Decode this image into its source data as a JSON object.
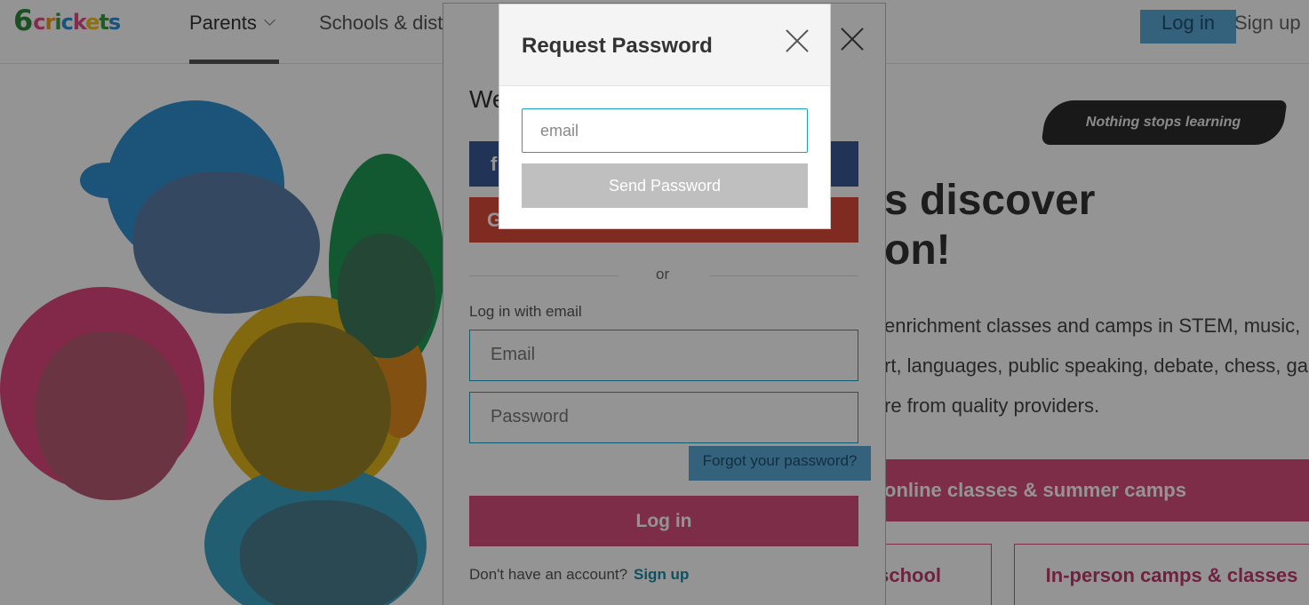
{
  "header": {
    "logo_text": "6crickets",
    "nav_parents": "Parents",
    "nav_schools": "Schools & dist",
    "login_label": "Log in",
    "signup_label": "Sign up"
  },
  "hero": {
    "tagline": "Nothing stops learning",
    "title_line1": "s discover",
    "title_line2": "on!",
    "desc_line1": "enrichment classes and camps in STEM, music,",
    "desc_line2": "rt, languages, public speaking, debate, chess, game",
    "desc_line3": "re from quality providers.",
    "cta_online": "online classes & summer camps",
    "cta_school": "school",
    "cta_inperson": "In-person camps & classes"
  },
  "login_modal": {
    "welcome_text": "We",
    "facebook_label": "f",
    "google_label": "G",
    "or_text": "or",
    "email_section_label": "Log in with email",
    "email_placeholder": "Email",
    "password_placeholder": "Password",
    "forgot_label": "Forgot your password?",
    "submit_label": "Log in",
    "no_account_text": "Don't have an account?",
    "signup_label": "Sign up"
  },
  "request_modal": {
    "title": "Request Password",
    "email_placeholder": "email",
    "email_value": "",
    "send_label": "Send Password"
  },
  "colors": {
    "accent_pink": "#d94f7e",
    "link_blue": "#1b9ec2",
    "facebook_blue": "#3b5998",
    "google_red": "#dd4b39"
  }
}
